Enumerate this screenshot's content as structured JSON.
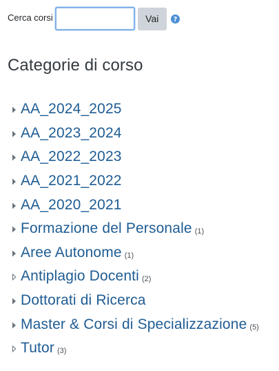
{
  "search": {
    "label": "Cerca corsi",
    "value": "",
    "placeholder": "",
    "button_label": "Vai",
    "help_icon": "question-circle-icon"
  },
  "heading": "Categorie di corso",
  "categories": [
    {
      "name": "AA_2024_2025",
      "count": "",
      "has_children": true
    },
    {
      "name": "AA_2023_2024",
      "count": "",
      "has_children": true
    },
    {
      "name": "AA_2022_2023",
      "count": "",
      "has_children": true
    },
    {
      "name": "AA_2021_2022",
      "count": "",
      "has_children": true
    },
    {
      "name": "AA_2020_2021",
      "count": "",
      "has_children": true
    },
    {
      "name": "Formazione del Personale",
      "count": "(1)",
      "has_children": true
    },
    {
      "name": "Aree Autonome",
      "count": "(1)",
      "has_children": true
    },
    {
      "name": "Antiplagio Docenti",
      "count": "(2)",
      "has_children": false
    },
    {
      "name": "Dottorati di Ricerca",
      "count": "",
      "has_children": true
    },
    {
      "name": "Master & Corsi di Specializzazione",
      "count": "(5)",
      "has_children": true
    },
    {
      "name": "Tutor",
      "count": "(3)",
      "has_children": false
    }
  ],
  "colors": {
    "link": "#1f5c93",
    "heading": "#343a40",
    "button_bg": "#ced4da",
    "help_icon": "#4a8fd6",
    "input_focus_border": "#7fb1e8"
  }
}
